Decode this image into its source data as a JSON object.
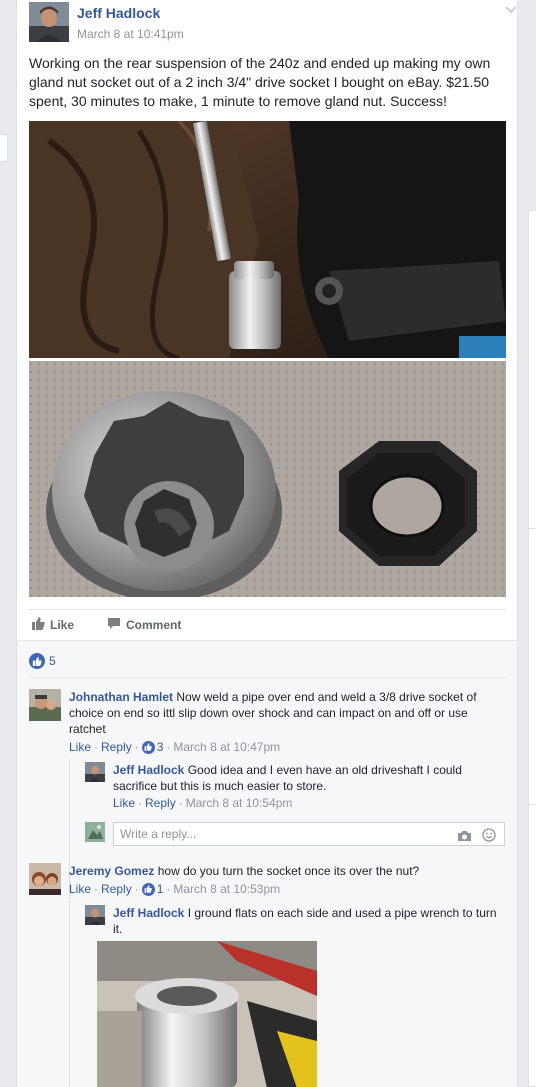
{
  "post": {
    "author": "Jeff Hadlock",
    "timestamp": "March 8 at 10:41pm",
    "text": "Working on the rear suspension of the 240z and ended up making my own gland nut socket out of a 2 inch 3/4\" drive socket I bought on eBay. $21.50 spent, 30 minutes to make, 1 minute to remove gland nut. Success!"
  },
  "actions": {
    "like_label": "Like",
    "comment_label": "Comment"
  },
  "reactions": {
    "like_count": "5"
  },
  "comments": [
    {
      "author": "Johnathan Hamlet",
      "text": "Now weld a pipe over end and weld a 3/8 drive socket of choice on end so ittl slip down over shock and can impact on and off or use ratchet",
      "like_label": "Like",
      "reply_label": "Reply",
      "likes": "3",
      "timestamp": "March 8 at 10:47pm",
      "replies": [
        {
          "author": "Jeff Hadlock",
          "text": "Good idea and I even have an old driveshaft I could sacrifice but this is much easier to store.",
          "like_label": "Like",
          "reply_label": "Reply",
          "timestamp": "March 8 at 10:54pm"
        }
      ],
      "reply_placeholder": "Write a reply..."
    },
    {
      "author": "Jeremy Gomez",
      "text": "how do you turn the socket once its over the nut?",
      "like_label": "Like",
      "reply_label": "Reply",
      "likes": "1",
      "timestamp": "March 8 at 10:53pm",
      "replies": [
        {
          "author": "Jeff Hadlock",
          "text": "I ground flats on each side and used a pipe wrench to turn it."
        }
      ]
    }
  ],
  "separator": "·",
  "colors": {
    "link": "#365899",
    "meta": "#90949c",
    "like_blue": "#4267b2",
    "comment_bg": "#f6f7f9"
  },
  "icons": {
    "chevron": "chevron-down-icon",
    "like": "thumbs-up-icon",
    "comment": "comment-bubble-icon",
    "camera": "camera-icon",
    "emoji": "smiley-icon"
  }
}
